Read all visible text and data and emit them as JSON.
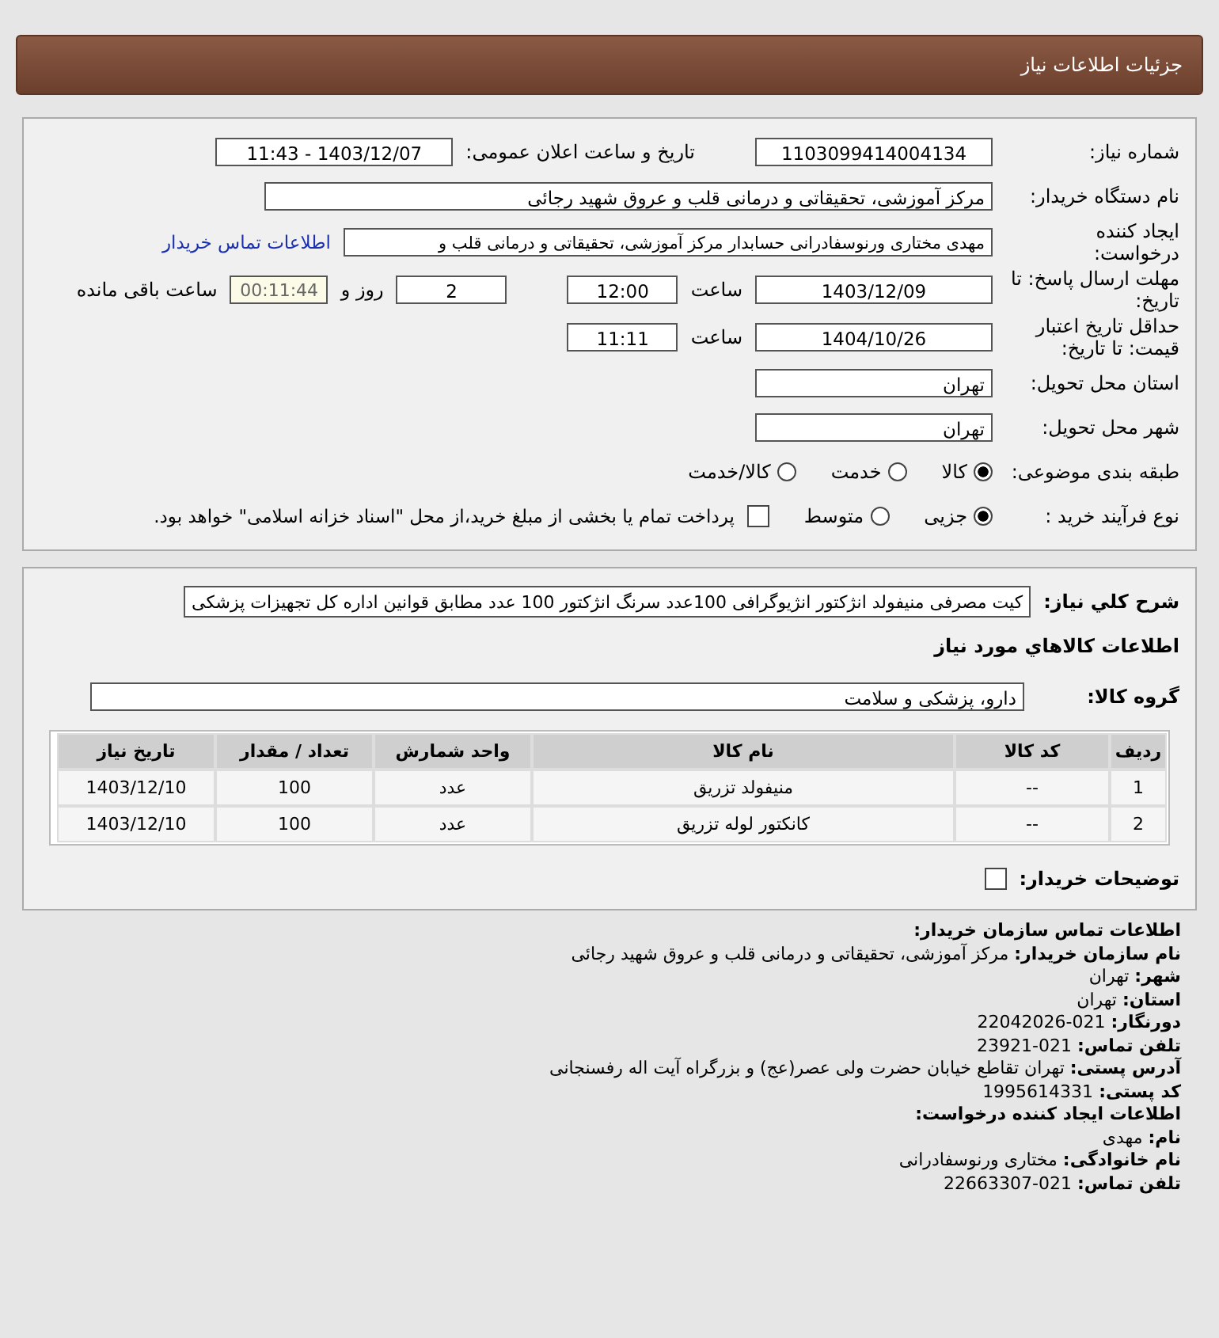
{
  "header": {
    "title": "جزئیات اطلاعات نیاز"
  },
  "need_number": {
    "label": "شماره نیاز:",
    "value": "1103099414004134"
  },
  "announce": {
    "label": "تاریخ و ساعت اعلان عمومی:",
    "value": "1403/12/07 - 11:43"
  },
  "buyer_org": {
    "label": "نام دستگاه خریدار:",
    "value": "مرکز آموزشی، تحقیقاتی و درمانی قلب و عروق شهید رجائی"
  },
  "requester": {
    "label": "ایجاد کننده درخواست:",
    "value": "مهدی مختاری ورنوسفادرانی حسابدار مرکز آموزشی، تحقیقاتی و درمانی قلب و",
    "link": "اطلاعات تماس خریدار"
  },
  "deadline": {
    "label": "مهلت ارسال پاسخ: تا تاریخ:",
    "date": "1403/12/09",
    "time_label": "ساعت",
    "time": "12:00",
    "days": "2",
    "days_label": "روز و",
    "remaining": "00:11:44",
    "remaining_label": "ساعت باقی مانده"
  },
  "validity": {
    "label": "حداقل تاریخ اعتبار قیمت: تا تاریخ:",
    "date": "1404/10/26",
    "time_label": "ساعت",
    "time": "11:11"
  },
  "province": {
    "label": "استان محل تحویل:",
    "value": "تهران"
  },
  "city": {
    "label": "شهر محل تحویل:",
    "value": "تهران"
  },
  "category": {
    "label": "طبقه بندی موضوعی:",
    "options": [
      {
        "label": "کالا",
        "selected": true
      },
      {
        "label": "خدمت",
        "selected": false
      },
      {
        "label": "کالا/خدمت",
        "selected": false
      }
    ]
  },
  "process": {
    "label": "نوع فرآیند خرید :",
    "options": [
      {
        "label": "جزیی",
        "selected": true
      },
      {
        "label": "متوسط",
        "selected": false
      }
    ],
    "payment": {
      "checked": false,
      "text": "پرداخت تمام یا بخشی از مبلغ خرید،از محل \"اسناد خزانه اسلامی\" خواهد بود."
    }
  },
  "description": {
    "label": "شرح کلي نياز:",
    "value": "کیت مصرفی منیفولد انژکتور انژیوگرافی 100عدد سرنگ انژکتور 100 عدد مطابق قوانین اداره کل تجهیزات پزشکی"
  },
  "goods_title": "اطلاعات کالاهاي مورد نياز",
  "goods_group": {
    "label": "گروه کالا:",
    "value": "دارو، پزشکی و سلامت"
  },
  "table": {
    "columns": [
      "ردیف",
      "کد کالا",
      "نام کالا",
      "واحد شمارش",
      "تعداد / مقدار",
      "تاریخ نیاز"
    ],
    "rows": [
      [
        "1",
        "--",
        "منیفولد تزریق",
        "عدد",
        "100",
        "1403/12/10"
      ],
      [
        "2",
        "--",
        "کانکتور لوله تزریق",
        "عدد",
        "100",
        "1403/12/10"
      ]
    ]
  },
  "buyer_notes": {
    "label": "توضیحات خریدار:",
    "checked": false
  },
  "contact": {
    "title": "اطلاعات تماس سازمان خریدار:",
    "lines": [
      {
        "label": "نام سازمان خریدار:",
        "value": "مرکز آموزشی، تحقیقاتی و درمانی قلب و عروق شهید رجائی"
      },
      {
        "label": "شهر:",
        "value": "تهران"
      },
      {
        "label": "استان:",
        "value": "تهران"
      },
      {
        "label": "دورنگار:",
        "value": "021-22042026"
      },
      {
        "label": "تلفن تماس:",
        "value": "021-23921"
      },
      {
        "label": "آدرس پستی:",
        "value": "تهران تقاطع خیابان حضرت ولی عصر(عج) و بزرگراه آیت اله رفسنجانی"
      },
      {
        "label": "کد پستی:",
        "value": "1995614331"
      }
    ]
  },
  "creator": {
    "title": "اطلاعات ایجاد کننده درخواست:",
    "lines": [
      {
        "label": "نام:",
        "value": "مهدی"
      },
      {
        "label": "نام خانوادگی:",
        "value": "مختاری ورنوسفادرانی"
      },
      {
        "label": "تلفن تماس:",
        "value": "021-22663307"
      }
    ]
  }
}
